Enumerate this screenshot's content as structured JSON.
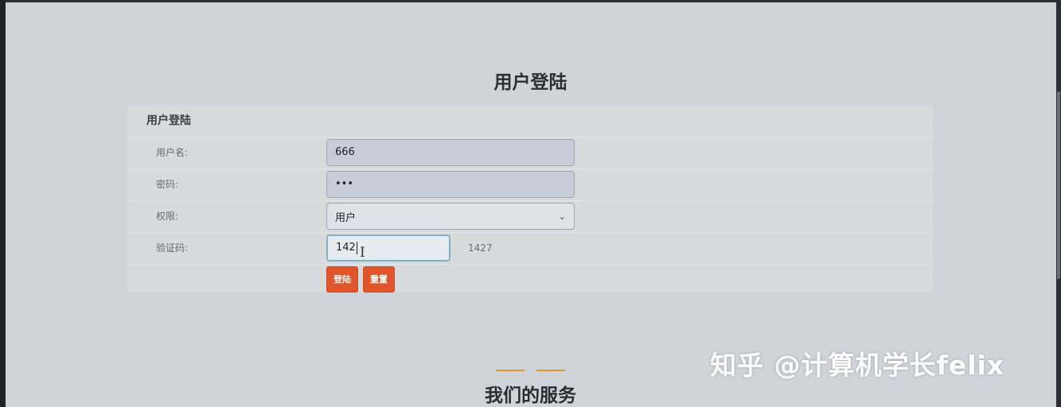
{
  "page": {
    "title": "用户登陆",
    "services_title": "我们的服务"
  },
  "form": {
    "header": "用户登陆",
    "username_label": "用户名:",
    "username_value": "666",
    "password_label": "密码:",
    "password_value": "•••",
    "role_label": "权限:",
    "role_selected": "用户",
    "captcha_label": "验证码:",
    "captcha_input_value": "142",
    "captcha_code": "1427",
    "login_label": "登陆",
    "reset_label": "重置"
  },
  "watermark": "知乎 @计算机学长felix",
  "colors": {
    "button": "#e0552a",
    "accent_line": "#e0962c",
    "focus_border": "#7fb2c9"
  },
  "icons": {
    "select_arrow": "chevron-down-icon",
    "cursor": "text-cursor-icon"
  }
}
